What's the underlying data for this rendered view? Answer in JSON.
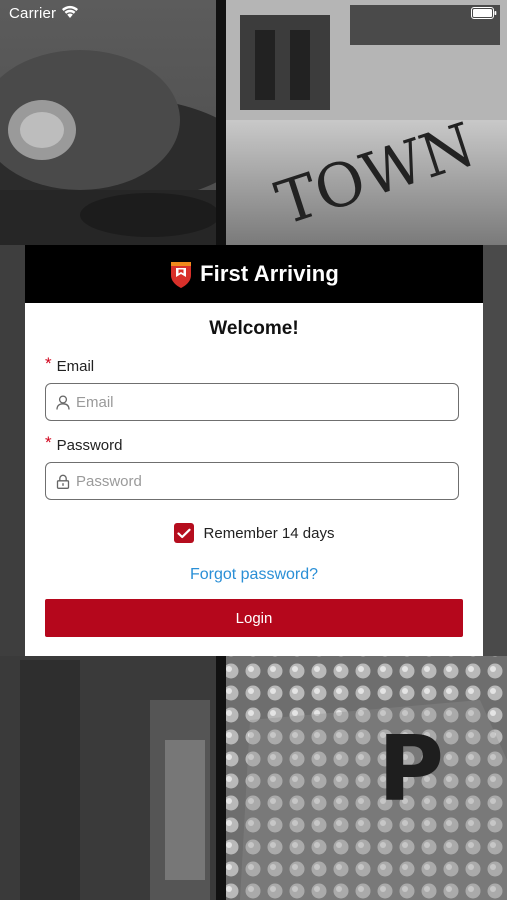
{
  "status_bar": {
    "carrier": "Carrier",
    "wifi_icon": "wifi-icon",
    "battery_icon": "battery-icon"
  },
  "brand": {
    "name": "First Arriving",
    "logo_icon": "shield-logo-icon",
    "accent_color": "#b5071c"
  },
  "login": {
    "welcome": "Welcome!",
    "email_label": "Email",
    "email_placeholder": "Email",
    "email_value": "",
    "password_label": "Password",
    "password_placeholder": "Password",
    "password_value": "",
    "required_marker": "*",
    "remember_label": "Remember 14 days",
    "remember_checked": true,
    "forgot_label": "Forgot password?",
    "login_label": "Login",
    "link_color": "#2a8fd6"
  }
}
